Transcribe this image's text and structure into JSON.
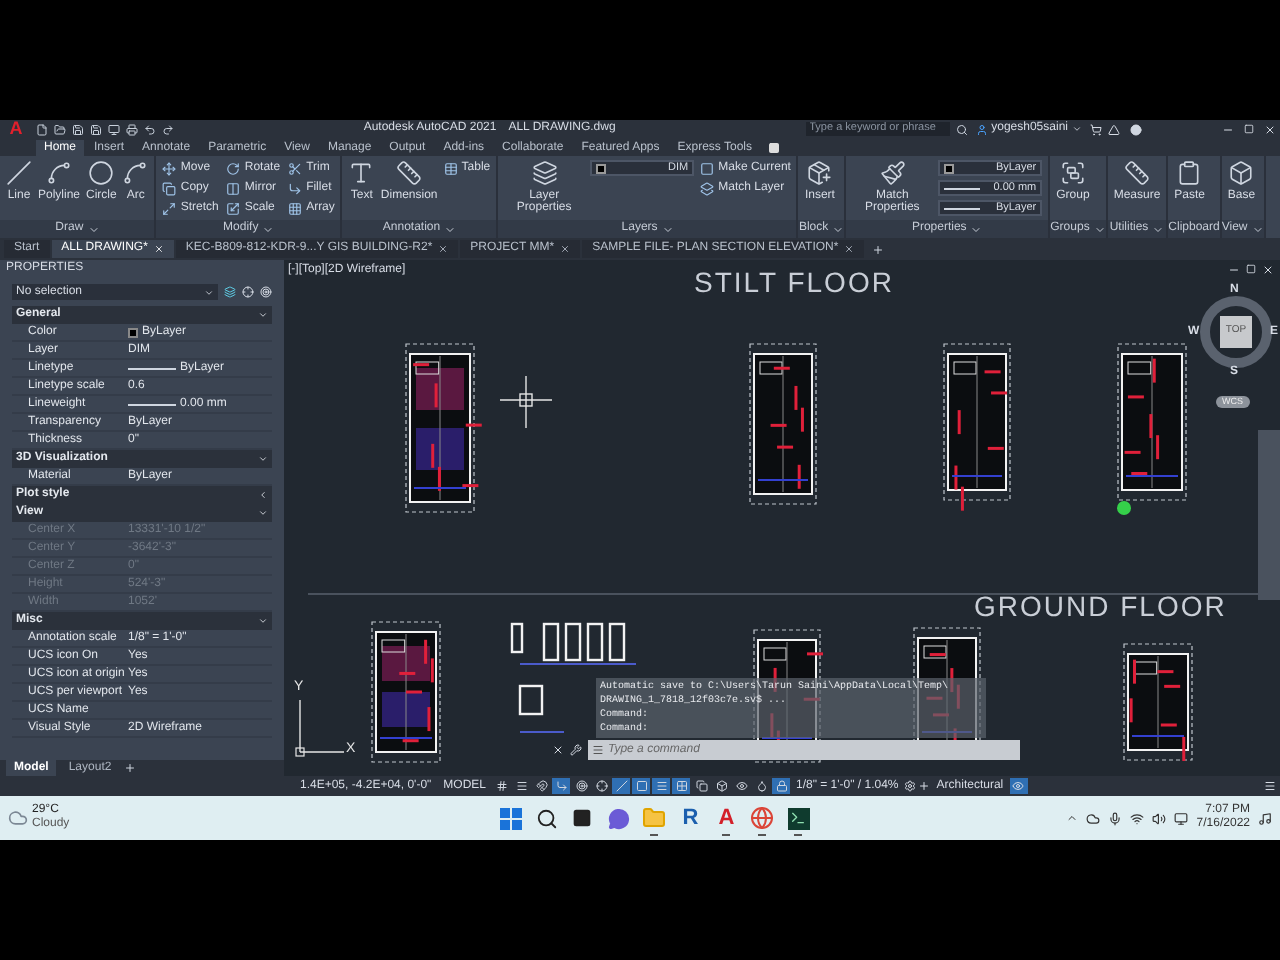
{
  "title_bar": {
    "logo": "A",
    "app_title": "Autodesk AutoCAD 2021",
    "file_title": "ALL DRAWING.dwg",
    "search": {
      "placeholder": "Type a keyword or phrase"
    },
    "user": "yogesh05saini"
  },
  "ribbon_tabs": [
    {
      "label": "Home",
      "selected": true
    },
    {
      "label": "Insert",
      "selected": false
    },
    {
      "label": "Annotate",
      "selected": false
    },
    {
      "label": "Parametric",
      "selected": false
    },
    {
      "label": "View",
      "selected": false
    },
    {
      "label": "Manage",
      "selected": false
    },
    {
      "label": "Output",
      "selected": false
    },
    {
      "label": "Add-ins",
      "selected": false
    },
    {
      "label": "Collaborate",
      "selected": false
    },
    {
      "label": "Featured Apps",
      "selected": false
    },
    {
      "label": "Express Tools",
      "selected": false
    }
  ],
  "ribbon_panels": [
    {
      "title": "Draw",
      "menu": true,
      "tools": [
        {
          "label": "Line",
          "kind": "large"
        },
        {
          "label": "Polyline",
          "kind": "large"
        },
        {
          "label": "Circle",
          "kind": "large"
        },
        {
          "label": "Arc",
          "kind": "large"
        }
      ]
    },
    {
      "title": "Modify",
      "menu": true,
      "tools": [
        {
          "label": "Move",
          "kind": "small"
        },
        {
          "label": "Copy",
          "kind": "small"
        },
        {
          "label": "Stretch",
          "kind": "small"
        },
        {
          "label": "Rotate",
          "kind": "small"
        },
        {
          "label": "Mirror",
          "kind": "small"
        },
        {
          "label": "Scale",
          "kind": "small"
        },
        {
          "label": "Trim",
          "kind": "small"
        },
        {
          "label": "Fillet",
          "kind": "small"
        },
        {
          "label": "Array",
          "kind": "small"
        }
      ]
    },
    {
      "title": "Annotation",
      "menu": true,
      "tools": [
        {
          "label": "Text",
          "kind": "large"
        },
        {
          "label": "Dimension",
          "kind": "large"
        },
        {
          "label": "Table",
          "kind": "small"
        }
      ]
    },
    {
      "title": "Layers",
      "menu": true,
      "dropdowns": [
        {
          "value": "DIM",
          "kind": "layer"
        }
      ],
      "tools": [
        {
          "label": "Layer Properties",
          "kind": "large"
        },
        {
          "label": "Make Current",
          "kind": "small"
        },
        {
          "label": "Match Layer",
          "kind": "small"
        }
      ]
    },
    {
      "title": "Block",
      "menu": true,
      "tools": [
        {
          "label": "Insert",
          "kind": "large"
        }
      ]
    },
    {
      "title": "Properties",
      "menu": true,
      "tools": [
        {
          "label": "Match Properties",
          "kind": "large"
        }
      ],
      "dropdowns": [
        {
          "value": "ByLayer",
          "kind": "color"
        },
        {
          "value": "0.00 mm",
          "kind": "line"
        },
        {
          "value": "ByLayer",
          "kind": "line"
        }
      ]
    },
    {
      "title": "Groups",
      "menu": true,
      "tools": [
        {
          "label": "Group",
          "kind": "large"
        }
      ]
    },
    {
      "title": "Utilities",
      "menu": true,
      "tools": [
        {
          "label": "Measure",
          "kind": "large"
        }
      ]
    },
    {
      "title": "Clipboard",
      "menu": false,
      "tools": [
        {
          "label": "Paste",
          "kind": "large"
        }
      ]
    },
    {
      "title": "View",
      "menu": true,
      "tools": [
        {
          "label": "Base",
          "kind": "large"
        }
      ]
    }
  ],
  "file_tabs": [
    {
      "label": "Start",
      "selected": false,
      "closable": false
    },
    {
      "label": "ALL DRAWING*",
      "selected": true,
      "closable": true
    },
    {
      "label": "KEC-B809-812-KDR-9...Y GIS BUILDING-R2*",
      "selected": false,
      "closable": true
    },
    {
      "label": "PROJECT MM*",
      "selected": false,
      "closable": true
    },
    {
      "label": "SAMPLE FILE- PLAN SECTION ELEVATION*",
      "selected": false,
      "closable": true
    }
  ],
  "properties": {
    "title": "PROPERTIES",
    "selection": "No selection",
    "sections": [
      {
        "title": "General",
        "expanded": true,
        "rows": [
          {
            "label": "Color",
            "value": "ByLayer",
            "kind": "color",
            "readonly": false
          },
          {
            "label": "Layer",
            "value": "DIM",
            "kind": "text",
            "readonly": false
          },
          {
            "label": "Linetype",
            "value": "ByLayer",
            "kind": "line",
            "readonly": false
          },
          {
            "label": "Linetype scale",
            "value": "0.6",
            "kind": "text",
            "readonly": false
          },
          {
            "label": "Lineweight",
            "value": "0.00 mm",
            "kind": "line",
            "readonly": false
          },
          {
            "label": "Transparency",
            "value": "ByLayer",
            "kind": "text",
            "readonly": false
          },
          {
            "label": "Thickness",
            "value": "0\"",
            "kind": "text",
            "readonly": false
          }
        ]
      },
      {
        "title": "3D Visualization",
        "expanded": true,
        "rows": [
          {
            "label": "Material",
            "value": "ByLayer",
            "kind": "text",
            "readonly": false
          }
        ]
      },
      {
        "title": "Plot style",
        "expanded": false
      },
      {
        "title": "View",
        "expanded": true,
        "rows": [
          {
            "label": "Center X",
            "value": "13331'-10 1/2\"",
            "kind": "text",
            "readonly": true
          },
          {
            "label": "Center Y",
            "value": "-3642'-3\"",
            "kind": "text",
            "readonly": true
          },
          {
            "label": "Center Z",
            "value": "0\"",
            "kind": "text",
            "readonly": true
          },
          {
            "label": "Height",
            "value": "524'-3\"",
            "kind": "text",
            "readonly": true
          },
          {
            "label": "Width",
            "value": "1052'",
            "kind": "text",
            "readonly": true
          }
        ]
      },
      {
        "title": "Misc",
        "expanded": true,
        "rows": [
          {
            "label": "Annotation scale",
            "value": "1/8\" = 1'-0\"",
            "kind": "text",
            "readonly": false
          },
          {
            "label": "UCS icon On",
            "value": "Yes",
            "kind": "text",
            "readonly": false
          },
          {
            "label": "UCS icon at origin",
            "value": "Yes",
            "kind": "text",
            "readonly": false
          },
          {
            "label": "UCS per viewport",
            "value": "Yes",
            "kind": "text",
            "readonly": false
          },
          {
            "label": "UCS Name",
            "kind": "text",
            "readonly": false
          },
          {
            "label": "Visual Style",
            "value": "2D Wireframe",
            "kind": "text",
            "readonly": false
          }
        ]
      }
    ]
  },
  "layout_tabs": [
    {
      "label": "Model",
      "selected": true
    },
    {
      "label": "Layout2",
      "selected": false
    }
  ],
  "canvas": {
    "viewport_label": "[-][Top][2D Wireframe]",
    "headings": [
      "STILT FLOOR",
      "GROUND FLOOR"
    ],
    "viewcube": {
      "top": "TOP",
      "north": "N",
      "south": "S",
      "east": "E",
      "west": "W",
      "ucs": "WCS"
    },
    "ucs_axes": [
      "Y",
      "X"
    ],
    "command_history": [
      "Automatic save to C:\\Users\\Tarun Saini\\AppData\\Local\\Temp\\",
      "DRAWING_1_7818_12f03c7e.sv$ ...",
      "Command:",
      "Command:"
    ],
    "command_input": {
      "placeholder": "Type a command"
    }
  },
  "status_bar": {
    "coordinates": "1.4E+05, -4.2E+04, 0'-0\"",
    "space": "MODEL",
    "toggles": [
      {
        "on": false
      },
      {
        "on": false
      },
      {
        "on": false
      },
      {
        "on": true
      },
      {
        "on": false
      },
      {
        "on": false
      },
      {
        "on": true
      },
      {
        "on": true
      },
      {
        "on": true
      },
      {
        "on": true
      },
      {
        "on": false
      },
      {
        "on": false
      },
      {
        "on": false
      },
      {
        "on": false
      },
      {
        "on": true
      }
    ],
    "annotation_scale": "1/8\" = 1'-0\" / 1.04%",
    "units": "Architectural",
    "isolate": {
      "on": true
    }
  },
  "taskbar": {
    "temperature": "29°C",
    "weather": "Cloudy",
    "apps": [
      {
        "kind": "start",
        "running": false
      },
      {
        "kind": "search",
        "running": false
      },
      {
        "kind": "taskview",
        "running": false
      },
      {
        "kind": "chat",
        "running": false
      },
      {
        "kind": "explorer",
        "running": true
      },
      {
        "kind": "letter",
        "label": "R",
        "running": false
      },
      {
        "kind": "letter",
        "label": "A",
        "running": true
      },
      {
        "kind": "browser",
        "running": true
      },
      {
        "kind": "terminal",
        "running": true
      }
    ],
    "time": "7:07 PM",
    "date": "7/16/2022"
  }
}
